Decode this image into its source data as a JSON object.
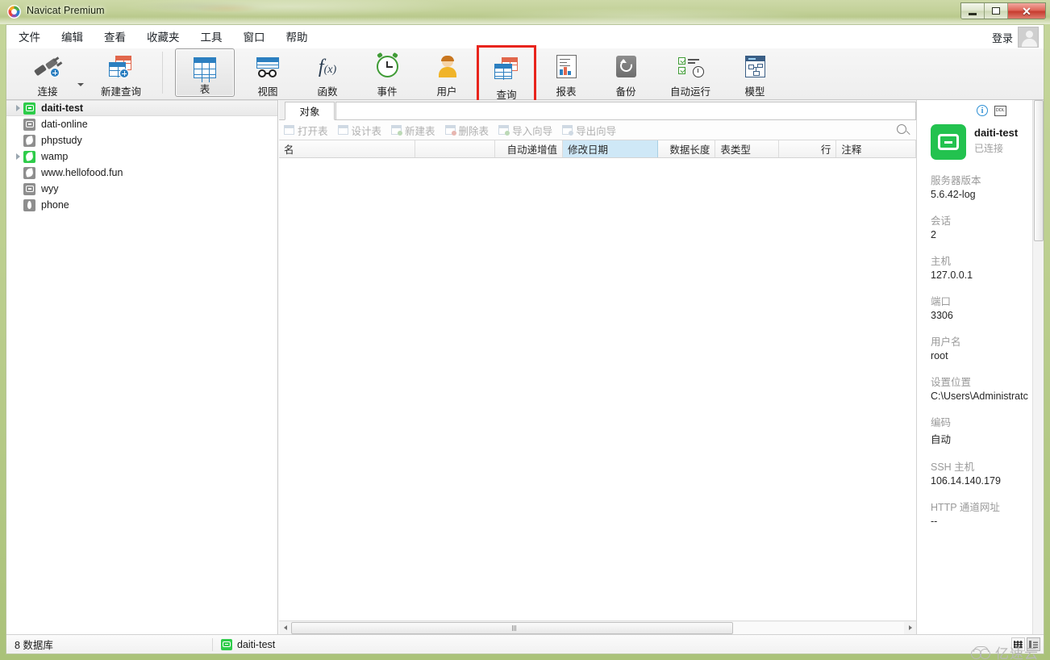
{
  "window": {
    "title": "Navicat Premium",
    "app_icon": "navicat-logo-icon",
    "minimize": "minimize-icon",
    "maximize": "maximize-icon",
    "close": "close-icon"
  },
  "menubar": {
    "items": [
      {
        "label": "文件"
      },
      {
        "label": "编辑"
      },
      {
        "label": "查看"
      },
      {
        "label": "收藏夹"
      },
      {
        "label": "工具"
      },
      {
        "label": "窗口"
      },
      {
        "label": "帮助"
      }
    ],
    "login_label": "登录",
    "avatar": "user-avatar-icon"
  },
  "toolbar": {
    "items": [
      {
        "label": "连接",
        "icon": "connection-plug-icon",
        "active": false
      },
      {
        "label": "新建查询",
        "icon": "new-query-icon",
        "active": false
      },
      {
        "label": "表",
        "icon": "table-grid-icon",
        "active": true
      },
      {
        "label": "视图",
        "icon": "view-glasses-icon",
        "active": false
      },
      {
        "label": "函数",
        "icon": "function-fx-icon",
        "active": false
      },
      {
        "label": "事件",
        "icon": "event-clock-icon",
        "active": false
      },
      {
        "label": "用户",
        "icon": "user-person-icon",
        "active": false
      },
      {
        "label": "查询",
        "icon": "query-icon",
        "active": false,
        "highlighted": true
      },
      {
        "label": "报表",
        "icon": "report-chart-icon",
        "active": false
      },
      {
        "label": "备份",
        "icon": "backup-restore-icon",
        "active": false
      },
      {
        "label": "自动运行",
        "icon": "automation-schedule-icon",
        "active": false
      },
      {
        "label": "模型",
        "icon": "model-diagram-icon",
        "active": false
      }
    ],
    "highlight_color": "#e8241c"
  },
  "tree": {
    "items": [
      {
        "label": "daiti-test",
        "icon": "mysql-connection-connected-icon",
        "expandable": true,
        "selected": true,
        "connected": true
      },
      {
        "label": "dati-online",
        "icon": "mysql-connection-icon",
        "expandable": false,
        "selected": false,
        "connected": false
      },
      {
        "label": "phpstudy",
        "icon": "mariadb-connection-icon",
        "expandable": false,
        "selected": false,
        "connected": false
      },
      {
        "label": "wamp",
        "icon": "mariadb-connection-connected-icon",
        "expandable": true,
        "selected": false,
        "connected": true
      },
      {
        "label": "www.hellofood.fun",
        "icon": "mariadb-connection-icon",
        "expandable": false,
        "selected": false,
        "connected": false
      },
      {
        "label": "wyy",
        "icon": "mysql-connection-icon",
        "expandable": false,
        "selected": false,
        "connected": false
      },
      {
        "label": "phone",
        "icon": "mongodb-connection-icon",
        "expandable": false,
        "selected": false,
        "connected": false
      }
    ]
  },
  "object_pane": {
    "tab_label": "对象",
    "actions": [
      {
        "label": "打开表",
        "icon": "open-table-icon",
        "enabled": false
      },
      {
        "label": "设计表",
        "icon": "design-table-icon",
        "enabled": false
      },
      {
        "label": "新建表",
        "icon": "new-table-icon",
        "enabled": false
      },
      {
        "label": "删除表",
        "icon": "delete-table-icon",
        "enabled": false
      },
      {
        "label": "导入向导",
        "icon": "import-wizard-icon",
        "enabled": false
      },
      {
        "label": "导出向导",
        "icon": "export-wizard-icon",
        "enabled": false
      }
    ],
    "search_icon": "search-icon",
    "columns": [
      {
        "label": "名",
        "width": 172,
        "align": "left",
        "sorted": false
      },
      {
        "label": "",
        "width": 100,
        "align": "left",
        "sorted": false
      },
      {
        "label": "自动递增值",
        "width": 85,
        "align": "right",
        "sorted": false
      },
      {
        "label": "修改日期",
        "width": 120,
        "align": "left",
        "sorted": true
      },
      {
        "label": "数据长度",
        "width": 72,
        "align": "right",
        "sorted": false
      },
      {
        "label": "表类型",
        "width": 80,
        "align": "left",
        "sorted": false
      },
      {
        "label": "行",
        "width": 72,
        "align": "right",
        "sorted": false
      },
      {
        "label": "注释",
        "width": 100,
        "align": "left",
        "sorted": false
      }
    ],
    "rows": []
  },
  "info_panel": {
    "tab_info_icon": "info-circle-icon",
    "tab_ddl_label": "DDL",
    "connection_name": "daiti-test",
    "connection_state": "已连接",
    "connection_logo": "mysql-connected-logo-icon",
    "fields": [
      {
        "key": "服务器版本",
        "value": "5.6.42-log"
      },
      {
        "key": "会话",
        "value": "2"
      },
      {
        "key": "主机",
        "value": "127.0.0.1"
      },
      {
        "key": "端口",
        "value": "3306"
      },
      {
        "key": "用户名",
        "value": "root"
      },
      {
        "key": "设置位置",
        "value": "C:\\Users\\Administratc"
      },
      {
        "key": "编码",
        "value": "自动"
      },
      {
        "key": "SSH 主机",
        "value": "106.14.140.179"
      },
      {
        "key": "HTTP 通道网址",
        "value": "--"
      }
    ]
  },
  "statusbar": {
    "database_count": "8 数据库",
    "active_connection": "daiti-test",
    "active_connection_icon": "mysql-connection-connected-icon",
    "view_grid_icon": "grid-view-icon",
    "view_detail_icon": "detail-view-icon"
  },
  "watermark": {
    "text": "亿速云",
    "icon": "cloud-icon"
  }
}
